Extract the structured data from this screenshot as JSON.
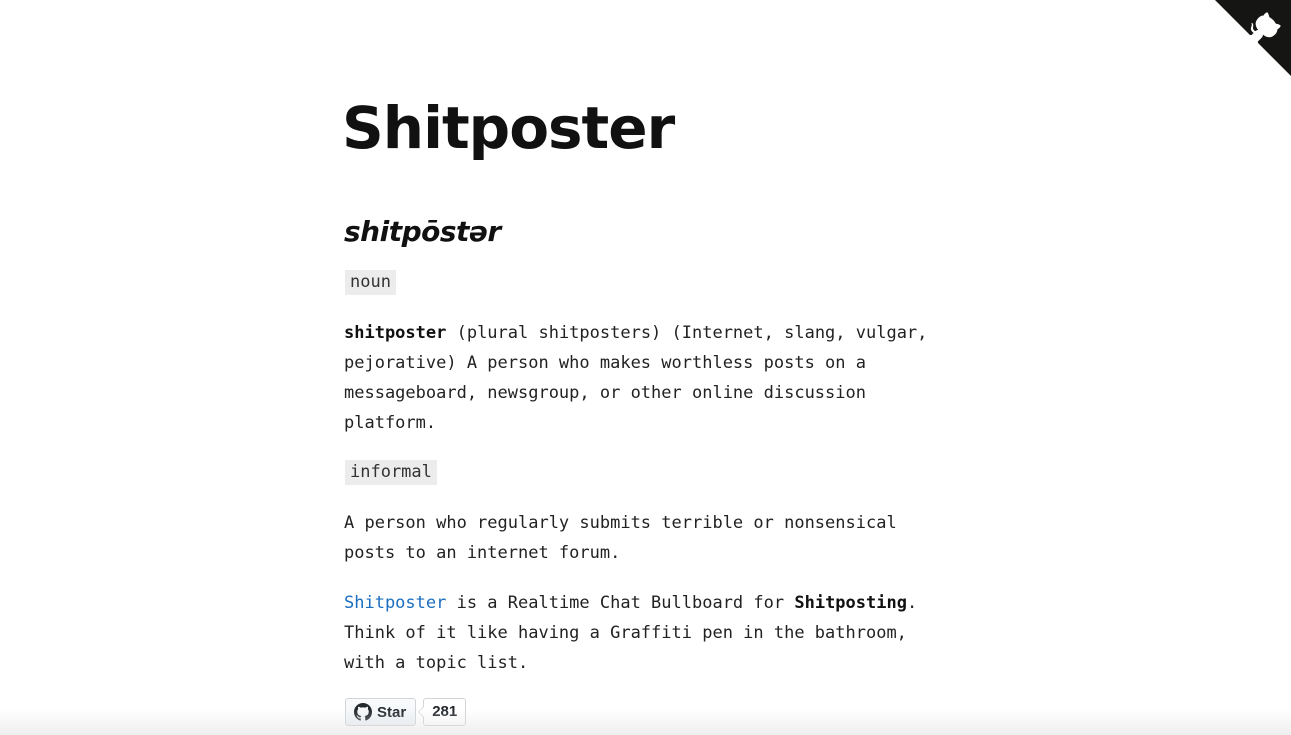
{
  "header": {
    "title": "Shitposter"
  },
  "definition": {
    "pronunciation": "shitpōstər",
    "noun_tag": "noun",
    "term": "shitposter",
    "noun_text": " (plural shitposters) (Internet, slang, vulgar, pejorative) A person who makes worthless posts on a messageboard, newsgroup, or other online discussion platform.",
    "informal_tag": "informal",
    "informal_text": "A person who regularly submits terrible or nonsensical posts to an internet forum."
  },
  "about": {
    "link_label": "Shitposter",
    "text_1": " is a Realtime Chat Bullboard for ",
    "bold_term": "Shitposting",
    "text_2": ". Think of it like having a Graffiti pen in the bathroom, with a topic list."
  },
  "github": {
    "star_label": "Star",
    "star_count": "281",
    "corner_icon": "github-octocat-icon",
    "star_icon": "github-mark-icon"
  },
  "colors": {
    "link": "#1a6ebd",
    "tag_bg": "#ececec",
    "corner": "#151513"
  }
}
